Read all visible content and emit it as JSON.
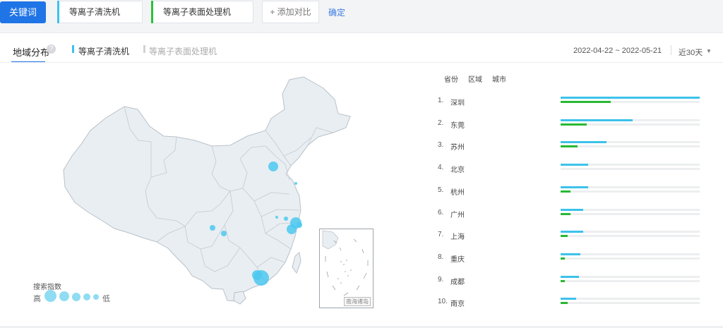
{
  "compare_bar": {
    "keyword_button": "关键词",
    "keyword_1": "等离子清洗机",
    "keyword_2": "等离子表面处理机",
    "add_compare": "+ 添加对比",
    "confirm": "确定"
  },
  "tabs": {
    "region_tab": "地域分布",
    "help_icon": "?",
    "legend_1": "等离子清洗机",
    "legend_2": "等离子表面处理机",
    "date_range": "2022-04-22 ~ 2022-05-21",
    "period": "近30天",
    "period_caret": "▼"
  },
  "map": {
    "inset_label": "南海诸岛",
    "scale_title": "搜索指数",
    "scale_high": "高",
    "scale_low": "低"
  },
  "ranking": {
    "tabs": [
      "省份",
      "区域",
      "城市"
    ],
    "rows": [
      {
        "num": "1.",
        "city": "深圳",
        "kw1": 100,
        "kw2": 36
      },
      {
        "num": "2.",
        "city": "东莞",
        "kw1": 52,
        "kw2": 19
      },
      {
        "num": "3.",
        "city": "苏州",
        "kw1": 33,
        "kw2": 12
      },
      {
        "num": "4.",
        "city": "北京",
        "kw1": 20,
        "kw2": 0
      },
      {
        "num": "5.",
        "city": "杭州",
        "kw1": 20,
        "kw2": 7
      },
      {
        "num": "6.",
        "city": "广州",
        "kw1": 16,
        "kw2": 7
      },
      {
        "num": "7.",
        "city": "上海",
        "kw1": 16,
        "kw2": 5
      },
      {
        "num": "8.",
        "city": "重庆",
        "kw1": 14,
        "kw2": 3
      },
      {
        "num": "9.",
        "city": "成都",
        "kw1": 13,
        "kw2": 3
      },
      {
        "num": "10.",
        "city": "南京",
        "kw1": 11,
        "kw2": 5
      }
    ]
  },
  "colors": {
    "accent": "#1f74e6",
    "keyword_1": "#3cc2ea",
    "keyword_2": "#2bc13b",
    "map_fill": "#e9eef2",
    "bubble": "#4cc8f0"
  }
}
